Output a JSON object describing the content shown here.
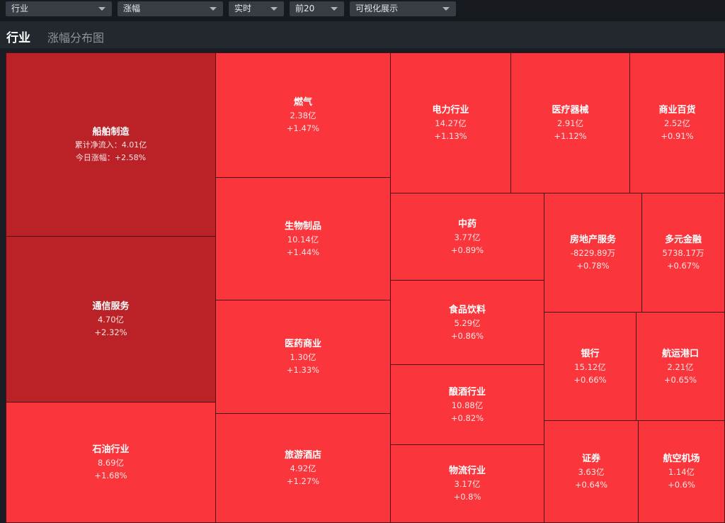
{
  "toolbar": {
    "category": "行业",
    "metric": "涨幅",
    "period": "实时",
    "topn": "前20",
    "view": "可视化展示"
  },
  "header": {
    "title": "行业",
    "subtitle": "涨幅分布图"
  },
  "tiles": [
    {
      "name": "船舶制造",
      "value": "累计净流入：4.01亿",
      "change": "今日涨幅：+2.58%"
    },
    {
      "name": "通信服务",
      "value": "4.70亿",
      "change": "+2.32%"
    },
    {
      "name": "石油行业",
      "value": "8.69亿",
      "change": "+1.68%"
    },
    {
      "name": "燃气",
      "value": "2.38亿",
      "change": "+1.47%"
    },
    {
      "name": "生物制品",
      "value": "10.14亿",
      "change": "+1.44%"
    },
    {
      "name": "医药商业",
      "value": "1.30亿",
      "change": "+1.33%"
    },
    {
      "name": "旅游酒店",
      "value": "4.92亿",
      "change": "+1.27%"
    },
    {
      "name": "电力行业",
      "value": "14.27亿",
      "change": "+1.13%"
    },
    {
      "name": "医疗器械",
      "value": "2.91亿",
      "change": "+1.12%"
    },
    {
      "name": "商业百货",
      "value": "2.52亿",
      "change": "+0.91%"
    },
    {
      "name": "中药",
      "value": "3.77亿",
      "change": "+0.89%"
    },
    {
      "name": "食品饮料",
      "value": "5.29亿",
      "change": "+0.86%"
    },
    {
      "name": "酿酒行业",
      "value": "10.88亿",
      "change": "+0.82%"
    },
    {
      "name": "物流行业",
      "value": "3.17亿",
      "change": "+0.8%"
    },
    {
      "name": "房地产服务",
      "value": "-8229.89万",
      "change": "+0.78%"
    },
    {
      "name": "多元金融",
      "value": "5738.17万",
      "change": "+0.67%"
    },
    {
      "name": "银行",
      "value": "15.12亿",
      "change": "+0.66%"
    },
    {
      "name": "航运港口",
      "value": "2.21亿",
      "change": "+0.65%"
    },
    {
      "name": "证券",
      "value": "3.63亿",
      "change": "+0.64%"
    },
    {
      "name": "航空机场",
      "value": "1.14亿",
      "change": "+0.6%"
    }
  ],
  "colors": {
    "tile_strong": "#bb2228",
    "tile": "#fa353b",
    "border": "#4a1116"
  }
}
